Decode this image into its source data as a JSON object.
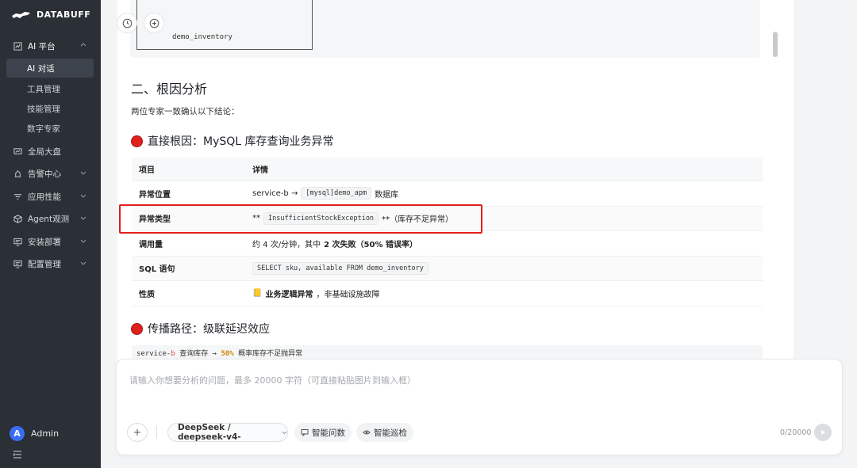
{
  "brand": {
    "name": "DATABUFF"
  },
  "sidebar": {
    "groups": [
      {
        "label": "AI 平台",
        "icon": "chart-icon",
        "open": true
      },
      {
        "label": "全局大盘",
        "icon": "dashboard-icon"
      },
      {
        "label": "告警中心",
        "icon": "alarm-icon"
      },
      {
        "label": "应用性能",
        "icon": "filter-icon"
      },
      {
        "label": "Agent观测",
        "icon": "cube-icon"
      },
      {
        "label": "安装部署",
        "icon": "monitor-icon"
      },
      {
        "label": "配置管理",
        "icon": "monitor-icon"
      }
    ],
    "sub_items": [
      {
        "label": "AI 对话",
        "active": true
      },
      {
        "label": "工具管理"
      },
      {
        "label": "技能管理"
      },
      {
        "label": "数字专家"
      }
    ]
  },
  "user": {
    "initial": "A",
    "name": "Admin"
  },
  "content": {
    "code_line": "demo_inventory",
    "section_title": "二、根因分析",
    "intro": "两位专家一致确认以下结论：",
    "root_cause_title": "直接根因：MySQL 库存查询业务异常",
    "table": {
      "headers": [
        "项目",
        "详情"
      ],
      "rows": [
        {
          "item": "异常位置",
          "pre": "service-b →",
          "code": "[mysql]demo_apm",
          "post": "数据库"
        },
        {
          "item": "异常类型",
          "pre": "**",
          "code": "InsufficientStockException",
          "post": "**（库存不足异常）"
        },
        {
          "item": "调用量",
          "pre": "约 4 次/分钟，其中",
          "bold": "2 次失败（50% 错误率）"
        },
        {
          "item": "SQL 语句",
          "code": "SELECT sku, available FROM demo_inventory"
        },
        {
          "item": "性质",
          "emoji": "📒",
          "bold": "业务逻辑异常",
          "post": "，非基础设施故障"
        }
      ]
    },
    "propagation_title": "传播路径：级联延迟效应",
    "propagation_code": {
      "svc": "service-",
      "svc_b": "b",
      "mid": " 查询库存 → ",
      "pct": "50%",
      "tail": " 概率库存不足抛异常"
    }
  },
  "input": {
    "placeholder": "请输入你想要分析的问题，最多 20000 字符（可直接粘贴图片到输入框）",
    "model": "DeepSeek / deepseek-v4-",
    "smart_ask": "智能问数",
    "smart_patrol": "智能巡检",
    "count": "0/20000"
  },
  "colors": {
    "sidebar_bg": "#2b2f36",
    "accent": "#3b6cf6",
    "alert_red": "#e0201b"
  }
}
